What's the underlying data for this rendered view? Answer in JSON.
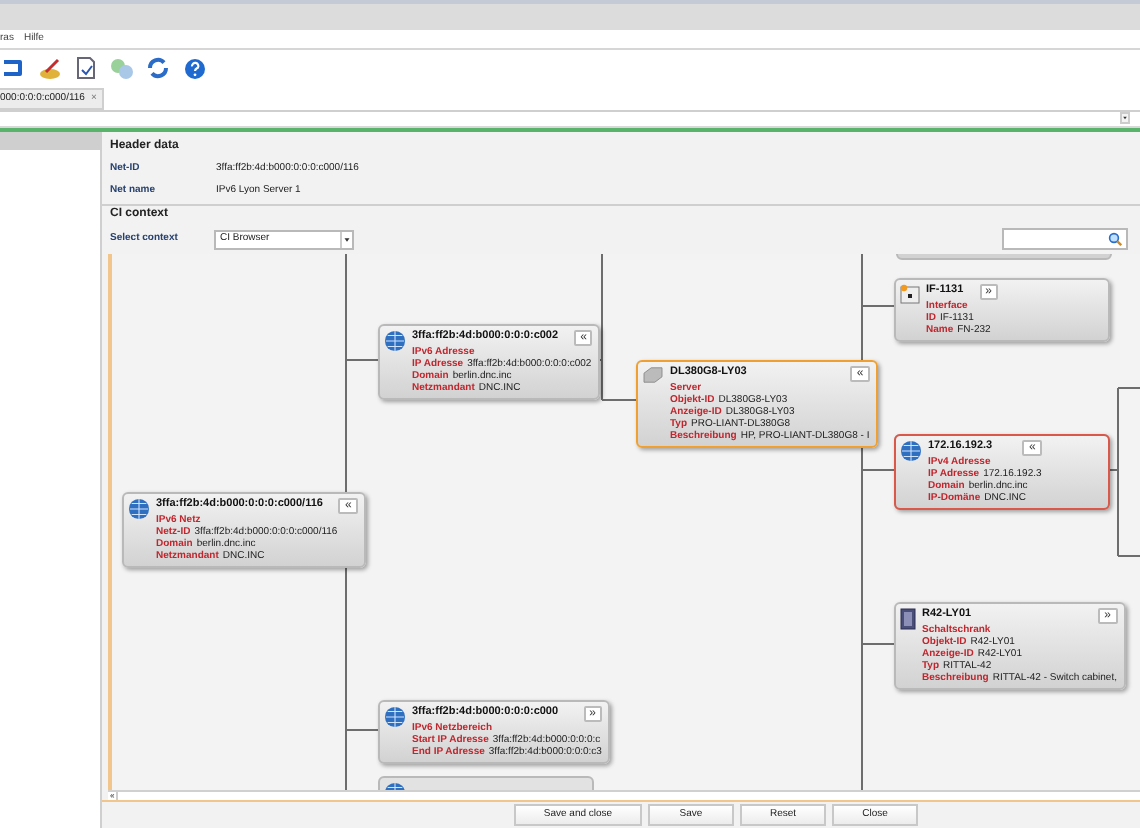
{
  "menu": [
    "ras",
    "Hilfe"
  ],
  "tab": {
    "label": "000:0:0:0:c000/116",
    "close": "×"
  },
  "header": {
    "title": "Header data",
    "fields": [
      {
        "label": "Net-ID",
        "value": "3ffa:ff2b:4d:b000:0:0:0:c000/116"
      },
      {
        "label": "Net name",
        "value": "IPv6 Lyon Server 1"
      }
    ]
  },
  "ci_context": {
    "title": "CI context",
    "select_label": "Select context",
    "select_value": "CI Browser"
  },
  "nodes": [
    {
      "kind": "globe",
      "title": "3ffa:ff2b:4d:b000:0:0:0:c000/116",
      "type": "IPv6 Netz",
      "toggle": "«",
      "selected": false,
      "marked": false,
      "fields": [
        {
          "label": "Netz-ID",
          "value": "3ffa:ff2b:4d:b000:0:0:0:c000/116"
        },
        {
          "label": "Domain",
          "value": "berlin.dnc.inc"
        },
        {
          "label": "Netzmandant",
          "value": "DNC.INC"
        }
      ]
    },
    {
      "kind": "globe",
      "title": "3ffa:ff2b:4d:b000:0:0:0:c002",
      "type": "IPv6 Adresse",
      "toggle": "«",
      "selected": false,
      "marked": false,
      "fields": [
        {
          "label": "IP Adresse",
          "value": "3ffa:ff2b:4d:b000:0:0:0:c002"
        },
        {
          "label": "Domain",
          "value": "berlin.dnc.inc"
        },
        {
          "label": "Netzmandant",
          "value": "DNC.INC"
        }
      ]
    },
    {
      "kind": "server",
      "title": "DL380G8-LY03",
      "type": "Server",
      "toggle": "«",
      "selected": true,
      "marked": false,
      "fields": [
        {
          "label": "Objekt-ID",
          "value": "DL380G8-LY03"
        },
        {
          "label": "Anzeige-ID",
          "value": "DL380G8-LY03"
        },
        {
          "label": "Typ",
          "value": "PRO-LIANT-DL380G8"
        },
        {
          "label": "Beschreibung",
          "value": "HP, PRO-LIANT-DL380G8 - I"
        }
      ]
    },
    {
      "kind": "interface",
      "title": "IF-1131",
      "type": "Interface",
      "toggle": "»",
      "selected": false,
      "marked": false,
      "fields": [
        {
          "label": "ID",
          "value": "IF-1131"
        },
        {
          "label": "Name",
          "value": "FN-232"
        }
      ]
    },
    {
      "kind": "globe",
      "title": "172.16.192.3",
      "type": "IPv4 Adresse",
      "toggle": "«",
      "selected": false,
      "marked": true,
      "fields": [
        {
          "label": "IP Adresse",
          "value": "172.16.192.3"
        },
        {
          "label": "Domain",
          "value": "berlin.dnc.inc"
        },
        {
          "label": "IP-Domäne",
          "value": "DNC.INC"
        }
      ]
    },
    {
      "kind": "cabinet",
      "title": "R42-LY01",
      "type": "Schaltschrank",
      "toggle": "»",
      "selected": false,
      "marked": false,
      "fields": [
        {
          "label": "Objekt-ID",
          "value": "R42-LY01"
        },
        {
          "label": "Anzeige-ID",
          "value": "R42-LY01"
        },
        {
          "label": "Typ",
          "value": "RITTAL-42"
        },
        {
          "label": "Beschreibung",
          "value": "RITTAL-42 - Switch cabinet,"
        }
      ]
    },
    {
      "kind": "globe",
      "title": "3ffa:ff2b:4d:b000:0:0:0:c000",
      "type": "IPv6 Netzbereich",
      "toggle": "»",
      "selected": false,
      "marked": false,
      "fields": [
        {
          "label": "Start IP Adresse",
          "value": "3ffa:ff2b:4d:b000:0:0:0:c"
        },
        {
          "label": "End IP Adresse",
          "value": "3ffa:ff2b:4d:b000:0:0:0:c3"
        }
      ]
    }
  ],
  "scroll_arrow": "«",
  "buttons": [
    "Save and close",
    "Save",
    "Reset",
    "Close"
  ]
}
